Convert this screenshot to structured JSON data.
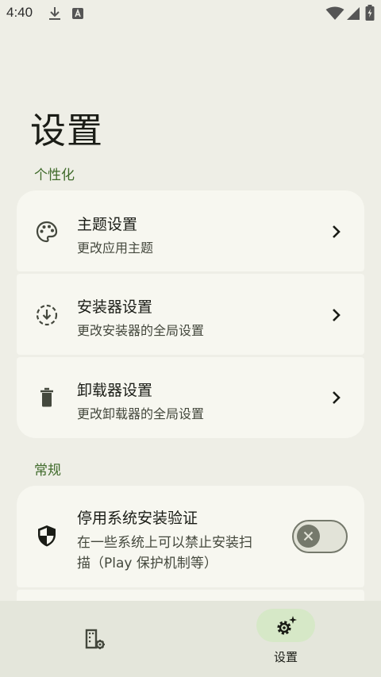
{
  "status_bar": {
    "time": "4:40"
  },
  "page_title": "设置",
  "sections": {
    "personalization": {
      "title": "个性化",
      "items": [
        {
          "title": "主题设置",
          "subtitle": "更改应用主题",
          "icon": "palette-icon"
        },
        {
          "title": "安装器设置",
          "subtitle": "更改安装器的全局设置",
          "icon": "download-circle-icon"
        },
        {
          "title": "卸载器设置",
          "subtitle": "更改卸载器的全局设置",
          "icon": "trash-icon"
        }
      ]
    },
    "general": {
      "title": "常规",
      "items": [
        {
          "title": "停用系统安装验证",
          "subtitle_line1": "在一些系统上可以禁止安装扫",
          "subtitle_line2": "描（Play 保护机制等）",
          "icon": "shield-icon",
          "toggle_on": false
        }
      ]
    }
  },
  "bottom_nav": {
    "items": [
      {
        "label": "",
        "icon": "app-settings-icon",
        "selected": false
      },
      {
        "label": "设置",
        "icon": "gear-sparkle-icon",
        "selected": true
      }
    ]
  },
  "colors": {
    "accent": "#3F6A2A",
    "background": "#EEEEE6",
    "card": "#F7F7F0",
    "nav_pill": "#D6E8C7"
  }
}
